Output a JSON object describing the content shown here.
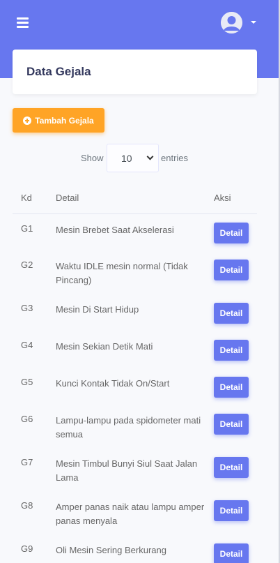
{
  "header": {
    "menu_icon": "hamburger-icon",
    "avatar_icon": "user-avatar-icon",
    "caret_icon": "caret-down-icon",
    "accent_color": "#6777ef"
  },
  "page": {
    "title": "Data Gejala"
  },
  "toolbar": {
    "add_label": "Tambah Gejala",
    "add_icon": "plus-circle-icon",
    "add_color": "#ffa426"
  },
  "table_controls": {
    "show_label": "Show",
    "entries_value": "10",
    "entries_label": "entries"
  },
  "table": {
    "columns": [
      "Kd",
      "Detail",
      "Aksi"
    ],
    "rows": [
      {
        "kd": "G1",
        "detail": "Mesin Brebet Saat Akselerasi",
        "action": "Detail"
      },
      {
        "kd": "G2",
        "detail": "Waktu IDLE mesin normal (Tidak Pincang)",
        "action": "Detail"
      },
      {
        "kd": "G3",
        "detail": "Mesin Di Start Hidup",
        "action": "Detail"
      },
      {
        "kd": "G4",
        "detail": "Mesin Sekian Detik Mati",
        "action": "Detail"
      },
      {
        "kd": "G5",
        "detail": "Kunci Kontak Tidak On/Start",
        "action": "Detail"
      },
      {
        "kd": "G6",
        "detail": "Lampu-lampu pada spidometer mati semua",
        "action": "Detail"
      },
      {
        "kd": "G7",
        "detail": "Mesin Timbul Bunyi Siul Saat Jalan Lama",
        "action": "Detail"
      },
      {
        "kd": "G8",
        "detail": "Amper panas naik atau lampu amper panas menyala",
        "action": "Detail"
      },
      {
        "kd": "G9",
        "detail": "Oli Mesin Sering Berkurang",
        "action": "Detail"
      }
    ]
  }
}
